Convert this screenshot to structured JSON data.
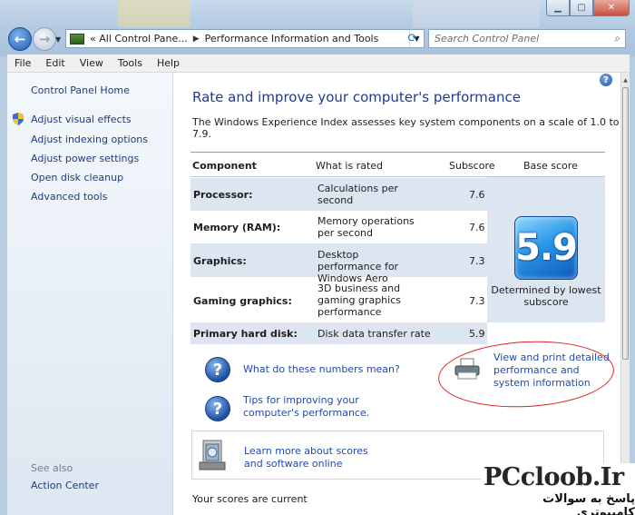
{
  "window": {
    "minimize_glyph": "▁",
    "maximize_glyph": "▢",
    "close_glyph": "✕"
  },
  "nav": {
    "back_glyph": "←",
    "forward_glyph": "→"
  },
  "address": {
    "prefix": "«",
    "segment1": "All Control Pane...",
    "segment2": "Performance Information and Tools"
  },
  "search": {
    "placeholder": "Search Control Panel"
  },
  "menu": [
    "File",
    "Edit",
    "View",
    "Tools",
    "Help"
  ],
  "sidebar": {
    "home": "Control Panel Home",
    "items": [
      "Adjust visual effects",
      "Adjust indexing options",
      "Adjust power settings",
      "Open disk cleanup",
      "Advanced tools"
    ],
    "see_also": "See also",
    "action_center": "Action Center"
  },
  "main": {
    "title": "Rate and improve your computer's performance",
    "intro": "The Windows Experience Index assesses key system components on a scale of 1.0 to 7.9.",
    "table": {
      "headers": [
        "Component",
        "What is rated",
        "Subscore",
        "Base score"
      ],
      "rows": [
        {
          "component": "Processor:",
          "what": "Calculations per second",
          "subscore": "7.6"
        },
        {
          "component": "Memory (RAM):",
          "what": "Memory operations per second",
          "subscore": "7.6"
        },
        {
          "component": "Graphics:",
          "what": "Desktop performance for Windows Aero",
          "subscore": "7.3"
        },
        {
          "component": "Gaming graphics:",
          "what": "3D business and gaming graphics performance",
          "subscore": "7.3"
        },
        {
          "component": "Primary hard disk:",
          "what": "Disk data transfer rate",
          "subscore": "5.9"
        }
      ],
      "base_score": "5.9",
      "base_caption": "Determined by lowest subscore"
    },
    "links": {
      "what_numbers": "What do these numbers mean?",
      "tips": "Tips for improving your computer's performance.",
      "view_print": "View and print detailed performance and system information",
      "learn_more": "Learn more about scores and software online"
    },
    "status": "Your scores are current"
  },
  "watermark": {
    "brand": "PCcloob.Ir",
    "tagline": "پاسخ به سوالات کامپیوتری"
  },
  "colors": {
    "link": "#1f4ab0",
    "title": "#1e3b8f",
    "highlight_ellipse": "#e02020",
    "score_tile": "#2c97e8"
  }
}
